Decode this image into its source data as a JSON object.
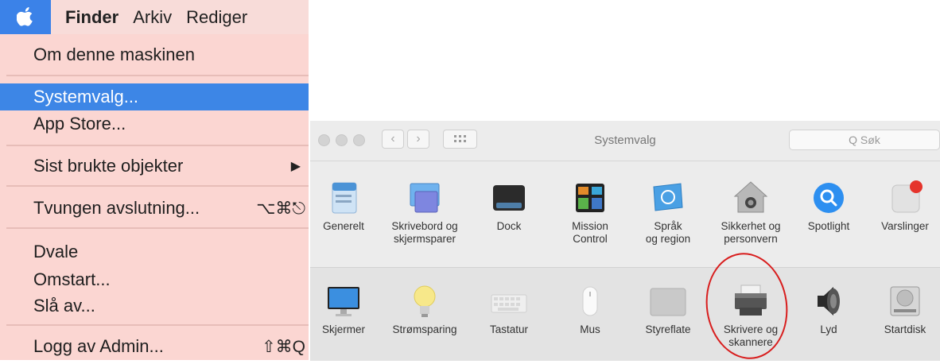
{
  "menubar": {
    "apple": "apple-icon",
    "items": [
      "Finder",
      "Arkiv",
      "Rediger"
    ]
  },
  "apple_menu": {
    "items": [
      {
        "label": "Om denne maskinen",
        "shortcut": ""
      },
      {
        "label": "Systemvalg...",
        "shortcut": ""
      },
      {
        "label": "App Store...",
        "shortcut": ""
      },
      {
        "label": "Sist brukte objekter",
        "shortcut": "▶"
      },
      {
        "label": "Tvungen avslutning...",
        "shortcut": "⌥⌘⎋"
      },
      {
        "label": "Dvale",
        "shortcut": ""
      },
      {
        "label": "Omstart...",
        "shortcut": ""
      },
      {
        "label": "Slå av...",
        "shortcut": ""
      },
      {
        "label": "Logg av Admin...",
        "shortcut": "⇧⌘Q"
      }
    ],
    "selected": "Systemvalg..."
  },
  "window": {
    "title": "Systemvalg",
    "search_placeholder": "Q Søk",
    "row1": [
      {
        "label": "Generelt",
        "icon": "general-icon"
      },
      {
        "label": "Skrivebord og\nskjermsparer",
        "icon": "desktop-icon"
      },
      {
        "label": "Dock",
        "icon": "dock-icon"
      },
      {
        "label": "Mission\nControl",
        "icon": "mission-control-icon"
      },
      {
        "label": "Språk\nog region",
        "icon": "language-region-icon"
      },
      {
        "label": "Sikkerhet og\npersonvern",
        "icon": "security-icon"
      },
      {
        "label": "Spotlight",
        "icon": "spotlight-icon"
      },
      {
        "label": "Varslinger",
        "icon": "notifications-icon"
      }
    ],
    "row2": [
      {
        "label": "Skjermer",
        "icon": "displays-icon"
      },
      {
        "label": "Strømsparing",
        "icon": "energy-saver-icon"
      },
      {
        "label": "Tastatur",
        "icon": "keyboard-icon"
      },
      {
        "label": "Mus",
        "icon": "mouse-icon"
      },
      {
        "label": "Styreflate",
        "icon": "trackpad-icon"
      },
      {
        "label": "Skrivere og\nskannere",
        "icon": "printer-icon"
      },
      {
        "label": "Lyd",
        "icon": "sound-icon"
      },
      {
        "label": "Startdisk",
        "icon": "startup-disk-icon"
      }
    ]
  },
  "colors": {
    "menu_bg": "#fbd6d2",
    "selection": "#3d86e6",
    "annotation": "#d81e1e"
  }
}
